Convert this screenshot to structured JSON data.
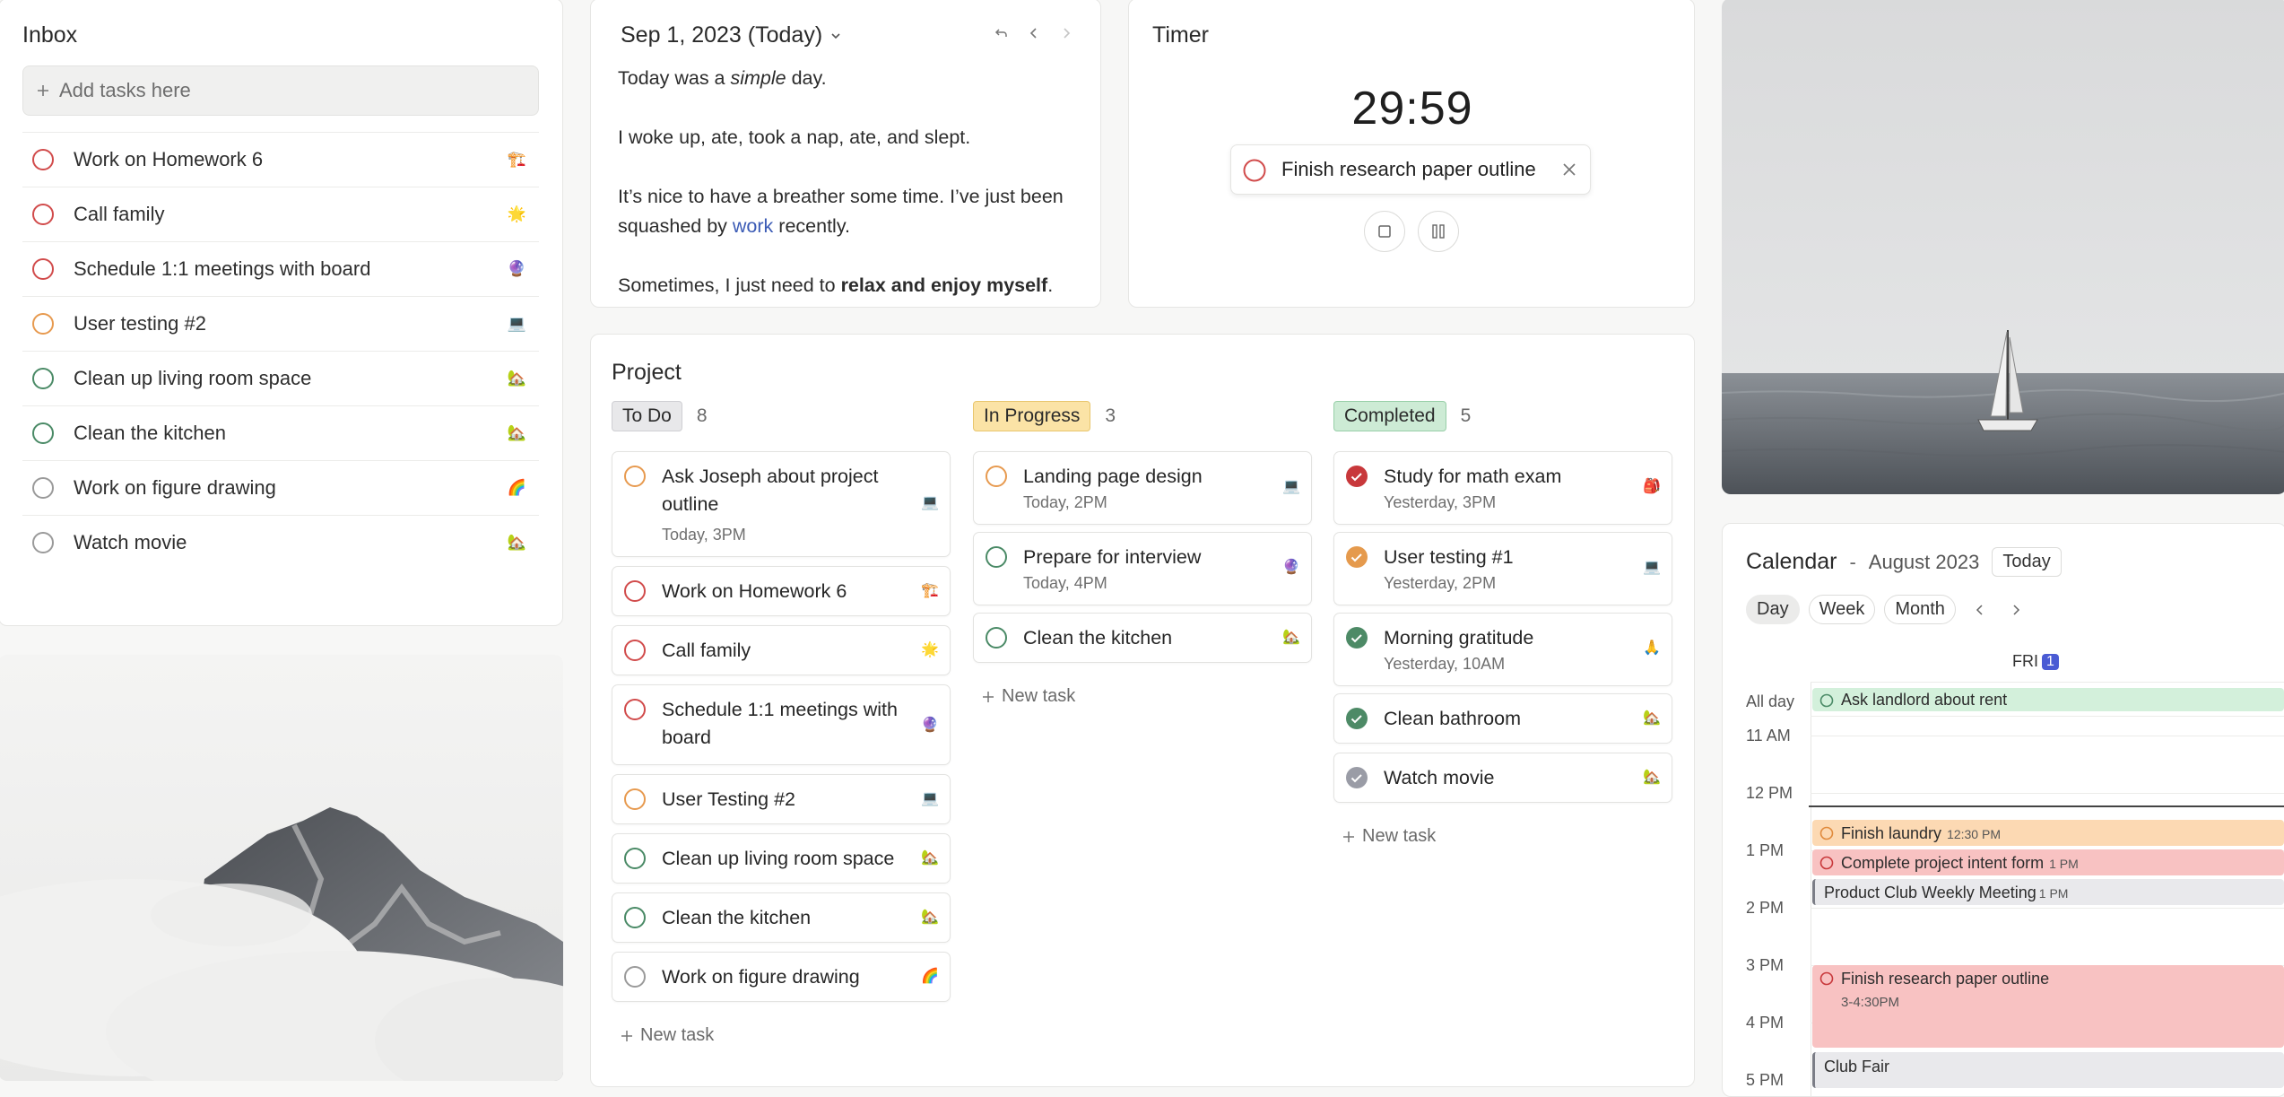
{
  "inbox": {
    "title": "Inbox",
    "add_placeholder": "Add tasks here",
    "items": [
      {
        "label": "Work on Homework 6",
        "emoji": "🏗️",
        "color": "#d14b4b"
      },
      {
        "label": "Call family",
        "emoji": "🌟",
        "color": "#d14b4b"
      },
      {
        "label": "Schedule 1:1 meetings with board",
        "emoji": "🔮",
        "color": "#d14b4b"
      },
      {
        "label": "User testing #2",
        "emoji": "💻",
        "color": "#e79a4f"
      },
      {
        "label": "Clean up living room space",
        "emoji": "🏡",
        "color": "#4a8a66"
      },
      {
        "label": "Clean the kitchen",
        "emoji": "🏡",
        "color": "#4a8a66"
      },
      {
        "label": "Work on figure drawing",
        "emoji": "🌈",
        "color": "#9a9a9a"
      },
      {
        "label": "Watch movie",
        "emoji": "🏡",
        "color": "#9a9a9a"
      }
    ]
  },
  "journal": {
    "date": "Sep 1, 2023 (Today)",
    "p1_a": "Today was a ",
    "p1_em": "simple",
    "p1_b": " day.",
    "p2": "I woke up, ate, took a nap, ate, and slept.",
    "p3_a": "It’s nice to have a breather some time. I’ve just been squashed by ",
    "p3_link": "work",
    "p3_b": " recently.",
    "p4_a": "Sometimes, I just need to ",
    "p4_strong": "relax and enjoy myself",
    "p4_b": "."
  },
  "timer": {
    "title": "Timer",
    "time": "29:59",
    "task": "Finish research paper outline"
  },
  "project": {
    "title": "Project",
    "new_task": "New task",
    "columns": [
      {
        "status": "To Do",
        "count": "8",
        "bg": "#e8e8ea",
        "border": "#cfcfd3"
      },
      {
        "status": "In Progress",
        "count": "3",
        "bg": "#fbe3a6",
        "border": "#e8c66d"
      },
      {
        "status": "Completed",
        "count": "5",
        "bg": "#cdebd5",
        "border": "#98cfa8"
      }
    ],
    "todo": [
      {
        "label": "Ask Joseph about project outline",
        "sub": "Today, 3PM",
        "emoji": "💻"
      },
      {
        "label": "Work on Homework 6",
        "emoji": "🏗️"
      },
      {
        "label": "Call family",
        "emoji": "🌟"
      },
      {
        "label": "Schedule 1:1 meetings with board",
        "emoji": "🔮"
      },
      {
        "label": "User Testing #2",
        "emoji": "💻"
      },
      {
        "label": "Clean up living room space",
        "emoji": "🏡"
      },
      {
        "label": "Clean the kitchen",
        "emoji": "🏡"
      },
      {
        "label": "Work on figure drawing",
        "emoji": "🌈"
      }
    ],
    "inprogress": [
      {
        "label": "Landing page design",
        "sub": "Today, 2PM",
        "emoji": "💻"
      },
      {
        "label": "Prepare for interview",
        "sub": "Today, 4PM",
        "emoji": "🔮"
      },
      {
        "label": "Clean the kitchen",
        "emoji": "🏡"
      }
    ],
    "completed": [
      {
        "label": "Study for math exam",
        "sub": "Yesterday, 3PM",
        "emoji": "🎒"
      },
      {
        "label": "User testing #1",
        "sub": "Yesterday, 2PM",
        "emoji": "💻"
      },
      {
        "label": "Morning gratitude",
        "sub": "Yesterday, 10AM",
        "emoji": "🙏"
      },
      {
        "label": "Clean bathroom",
        "emoji": "🏡"
      },
      {
        "label": "Watch movie",
        "emoji": "🏡"
      }
    ]
  },
  "calendar": {
    "title": "Calendar",
    "dash": "-",
    "month": "August 2023",
    "today": "Today",
    "views": [
      "Day",
      "Week",
      "Month"
    ],
    "day_name": "FRI",
    "day_num": "1",
    "all_day": "All day",
    "hours": [
      "11 AM",
      "12 PM",
      "1 PM",
      "2 PM",
      "3 PM",
      "4 PM",
      "5 PM"
    ],
    "events": {
      "allday": "Ask landlord about rent",
      "laundry": "Finish laundry",
      "laundry_time": "12:30 PM",
      "intent": "Complete project intent form",
      "intent_time": "1 PM",
      "club": "Product Club Weekly Meeting",
      "club_time": "1 PM",
      "research": "Finish research paper outline",
      "research_time": "3-4:30PM",
      "fair": "Club Fair"
    }
  }
}
